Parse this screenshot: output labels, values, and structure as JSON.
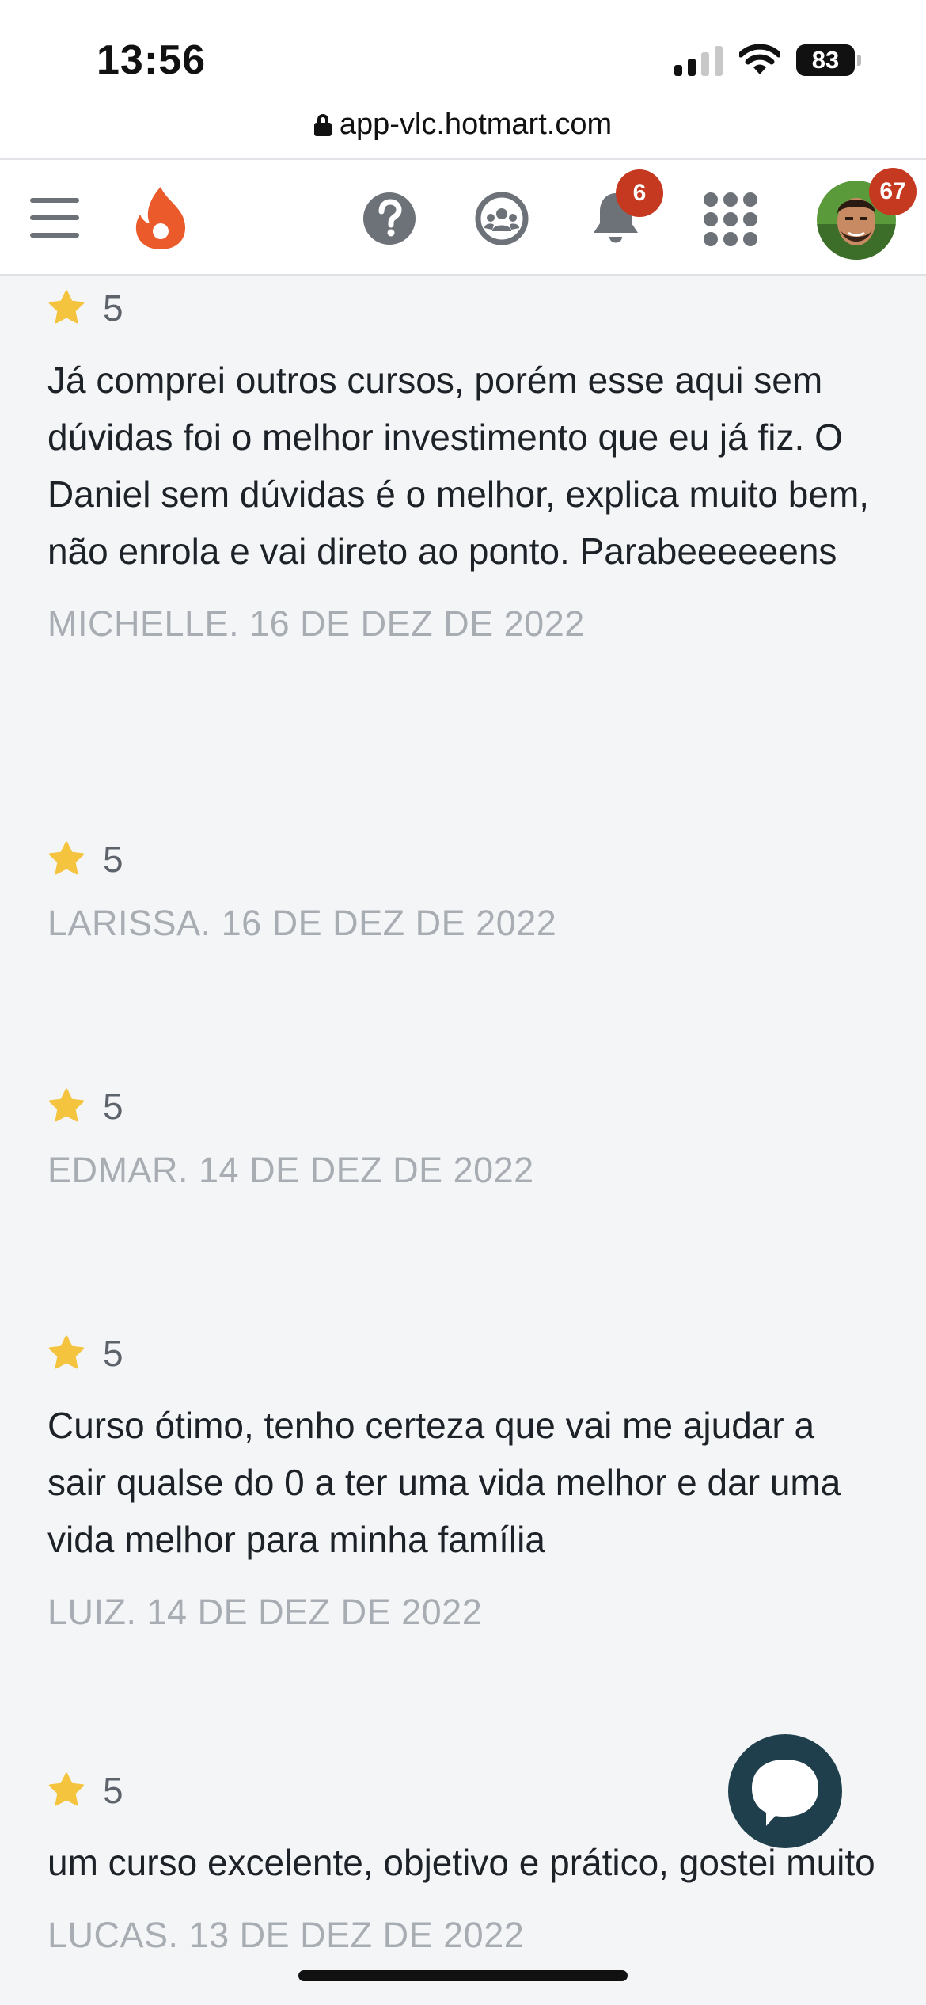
{
  "status_bar": {
    "time": "13:56",
    "battery": "83"
  },
  "browser": {
    "url": "app-vlc.hotmart.com"
  },
  "header": {
    "notifications_badge": "6",
    "profile_badge": "67"
  },
  "reviews": [
    {
      "rating": "5",
      "text": "Já comprei outros cursos, porém esse aqui sem dúvidas foi o melhor investimento que eu já fiz. O Daniel sem dúvidas é o melhor, explica muito bem, não enrola e vai direto ao ponto. Parabeeeeeens",
      "meta": "MICHELLE. 16 DE DEZ DE 2022"
    },
    {
      "rating": "5",
      "text": "",
      "meta": "LARISSA. 16 DE DEZ DE 2022"
    },
    {
      "rating": "5",
      "text": "",
      "meta": "EDMAR. 14 DE DEZ DE 2022"
    },
    {
      "rating": "5",
      "text": "Curso ótimo, tenho certeza que vai me ajudar a sair qualse do 0 a ter uma vida melhor e dar uma vida melhor para minha família",
      "meta": "LUIZ. 14 DE DEZ DE 2022"
    },
    {
      "rating": "5",
      "text": "um curso excelente, objetivo e prático, gostei muito",
      "meta": "LUCAS. 13 DE DEZ DE 2022"
    }
  ],
  "colors": {
    "accent_flame": "#ea5a2a",
    "badge": "#c4391f",
    "star": "#f4c43f",
    "chat": "#1f3f4d"
  }
}
